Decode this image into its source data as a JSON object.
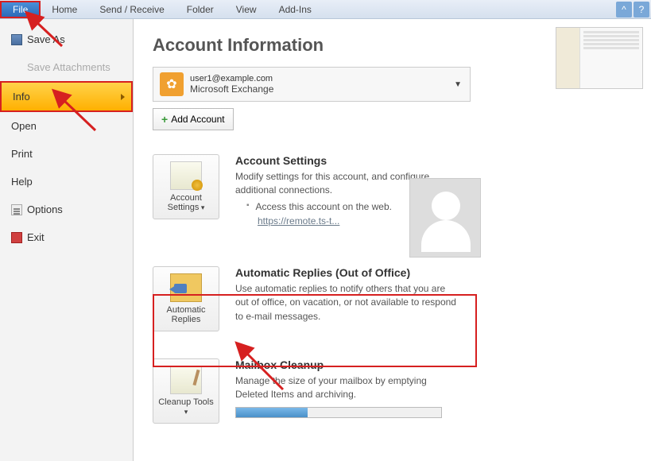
{
  "ribbon": {
    "file": "File",
    "tabs": [
      "Home",
      "Send / Receive",
      "Folder",
      "View",
      "Add-Ins"
    ]
  },
  "sidebar": {
    "save_as": "Save As",
    "save_attachments": "Save Attachments",
    "info": "Info",
    "open": "Open",
    "print": "Print",
    "help": "Help",
    "options": "Options",
    "exit": "Exit"
  },
  "main": {
    "title": "Account Information",
    "account": {
      "email": "user1@example.com",
      "type": "Microsoft Exchange"
    },
    "add_account": "Add Account",
    "settings": {
      "button": "Account Settings",
      "title": "Account Settings",
      "desc": "Modify settings for this account, and configure additional connections.",
      "bullet": "Access this account on the web.",
      "link": "https://remote.ts-t..."
    },
    "auto_replies": {
      "button": "Automatic Replies",
      "title": "Automatic Replies (Out of Office)",
      "desc": "Use automatic replies to notify others that you are out of office, on vacation, or not available to respond to e-mail messages."
    },
    "cleanup": {
      "button": "Cleanup Tools",
      "title": "Mailbox Cleanup",
      "desc": "Manage the size of your mailbox by emptying Deleted Items and archiving."
    }
  }
}
